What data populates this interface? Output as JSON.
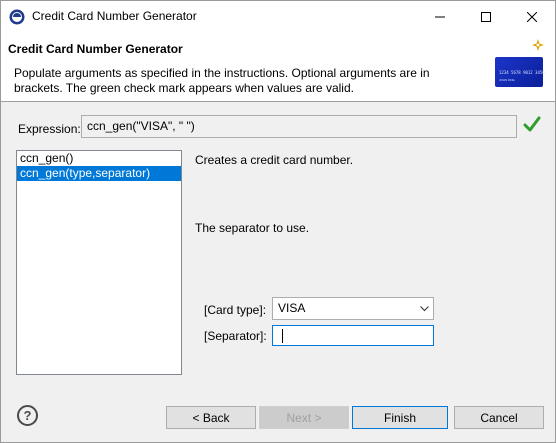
{
  "window": {
    "title": "Credit Card Number Generator"
  },
  "banner": {
    "title": "Credit Card Number Generator",
    "description": "Populate arguments as specified in the instructions. Optional arguments are in brackets. The green check mark appears when values are valid.",
    "card_number": "1234 5678 9012 3456",
    "card_name": "JOHN DOE"
  },
  "expression": {
    "label": "Expression:",
    "value": "ccn_gen(\"VISA\", \" \")",
    "valid": true
  },
  "functions": {
    "items": [
      {
        "label": "ccn_gen()",
        "selected": false
      },
      {
        "label": "ccn_gen(type,separator)",
        "selected": true
      }
    ]
  },
  "details": {
    "function_description": "Creates a credit card number.",
    "argument_description": "The separator to use."
  },
  "arguments": {
    "card_type_label": "[Card type]:",
    "card_type_value": "VISA",
    "separator_label": "[Separator]:",
    "separator_value": ""
  },
  "buttons": {
    "help": "?",
    "back": "< Back",
    "next": "Next >",
    "finish": "Finish",
    "cancel": "Cancel"
  },
  "colors": {
    "accent": "#0078d7",
    "check": "#2e9e2e",
    "card": "#1c35c9"
  }
}
